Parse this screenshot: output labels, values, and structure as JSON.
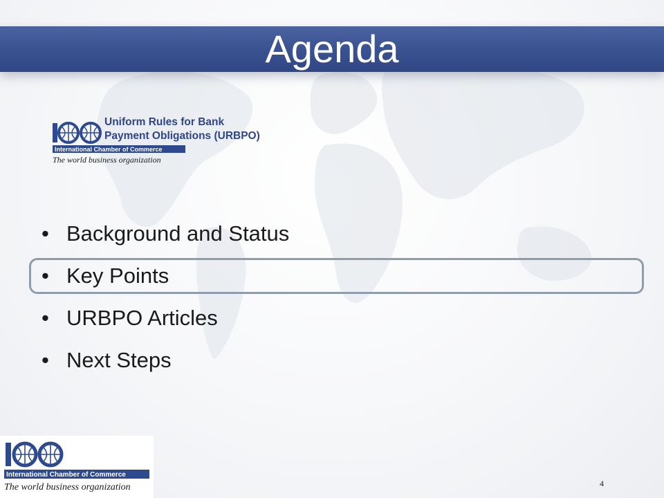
{
  "slide": {
    "title": "Agenda",
    "subtitle_lines": [
      "Uniform Rules for Bank",
      "Payment Obligations (URBPO)"
    ],
    "agenda_items": [
      {
        "bullet": "•",
        "label": "Background and Status"
      },
      {
        "bullet": "•",
        "label": "Key Points",
        "highlighted": true
      },
      {
        "bullet": "•",
        "label": "URBPO Articles"
      },
      {
        "bullet": "•",
        "label": "Next Steps"
      }
    ],
    "page_number": "4"
  },
  "logo": {
    "letters": "ICC",
    "name": "International Chamber of Commerce",
    "tagline": "The world business organization"
  },
  "colors": {
    "title_band": "#3a5190",
    "subtitle_text": "#2f4587",
    "logo_blue": "#2e4a8f",
    "highlight_border": "#8f9cab"
  }
}
